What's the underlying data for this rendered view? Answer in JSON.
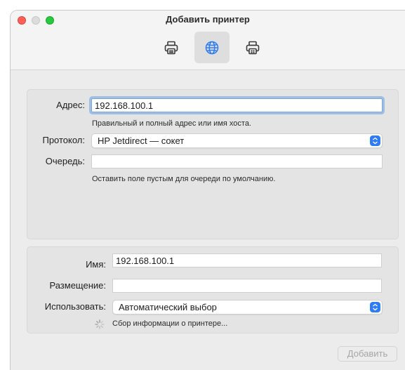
{
  "window": {
    "title": "Добавить принтер"
  },
  "toolbar": {
    "items": [
      {
        "icon": "default-printer-icon",
        "active": false
      },
      {
        "icon": "ip-globe-icon",
        "active": true
      },
      {
        "icon": "windows-printer-icon",
        "active": false
      }
    ]
  },
  "connection": {
    "address_label": "Адрес:",
    "address_value": "192.168.100.1",
    "address_hint": "Правильный и полный адрес или имя хоста.",
    "protocol_label": "Протокол:",
    "protocol_value": "HP Jetdirect — сокет",
    "queue_label": "Очередь:",
    "queue_value": "",
    "queue_hint": "Оставить поле пустым для очереди по умолчанию."
  },
  "printer": {
    "name_label": "Имя:",
    "name_value": "192.168.100.1",
    "location_label": "Размещение:",
    "location_value": "",
    "use_label": "Использовать:",
    "use_value": "Автоматический выбор",
    "status_text": "Сбор информации о принтере..."
  },
  "footer": {
    "add_button": "Добавить"
  },
  "colors": {
    "accent": "#2f7df6",
    "focus_ring": "#4a90e2"
  }
}
